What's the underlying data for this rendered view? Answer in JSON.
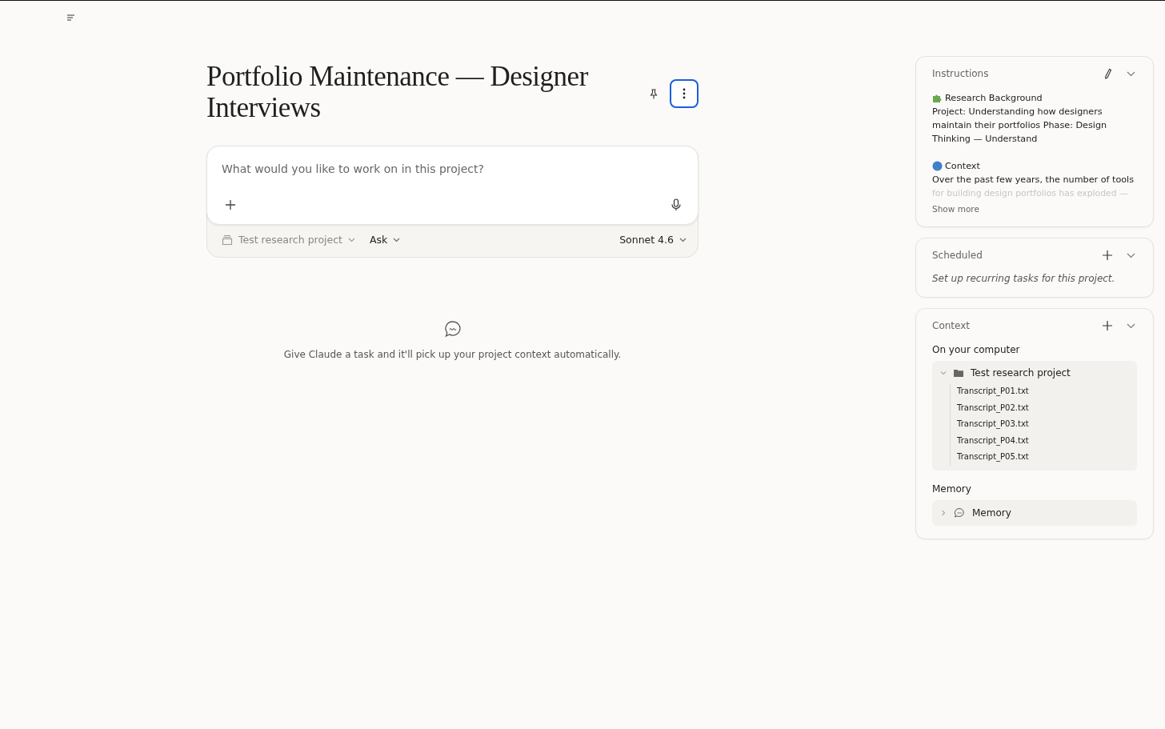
{
  "project": {
    "title": "Portfolio Maintenance — Designer Interviews",
    "more_focused": true
  },
  "composer": {
    "placeholder": "What would you like to work on in this project?",
    "project": "Test research project",
    "mode": "Ask",
    "model": "Sonnet 4.6"
  },
  "empty_state": {
    "text": "Give Claude a task and it'll pick up your project context automatically."
  },
  "instructions": {
    "title": "Instructions",
    "sections": [
      {
        "kind": "puzzle",
        "heading": "Research Background",
        "body": "Project: Understanding how designers maintain their portfolios Phase: Design Thinking — Understand"
      },
      {
        "kind": "globe",
        "heading": "Context",
        "body": "Over the past few years, the number of tools"
      }
    ],
    "faded": "for building design portfolios has exploded —",
    "show_more": "Show more"
  },
  "scheduled": {
    "title": "Scheduled",
    "hint": "Set up recurring tasks for this project."
  },
  "context": {
    "title": "Context",
    "computer_label": "On your computer",
    "folder": {
      "name": "Test research project",
      "expanded": true,
      "children": [
        {
          "name": "Transcript_P01.txt"
        },
        {
          "name": "Transcript_P02.txt"
        },
        {
          "name": "Transcript_P03.txt"
        },
        {
          "name": "Transcript_P04.txt"
        },
        {
          "name": "Transcript_P05.txt"
        }
      ]
    },
    "memory_label": "Memory",
    "memory": {
      "name": "Memory",
      "expanded": false
    }
  }
}
